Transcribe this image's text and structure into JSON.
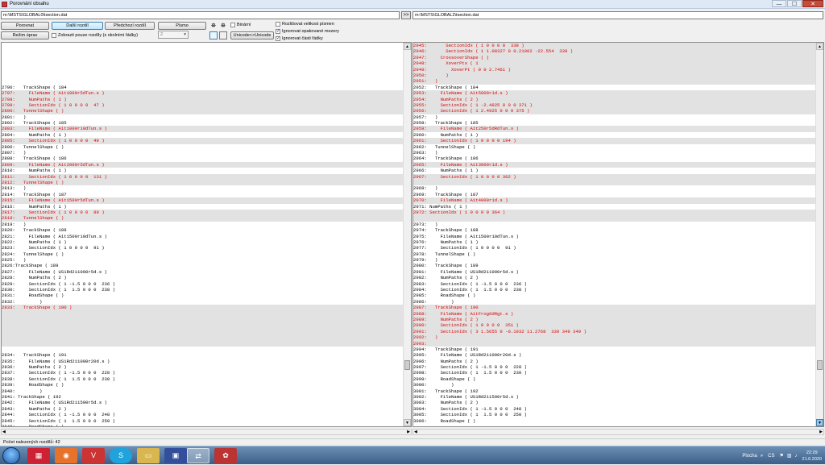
{
  "window": {
    "title": "Porovnání obsahu",
    "min": "—",
    "max": "☐",
    "close": "✕"
  },
  "paths": {
    "left": "m:\\MSTS\\GLOBAL0\\tsection.dat",
    "right": "m:\\MSTS\\GLOBAL2\\tsection.dat",
    "arrow": ">>"
  },
  "toolbar": {
    "compare": "Porovnat",
    "next_diff": "Další rozdíl",
    "prev_diff": "Předchozí rozdíl",
    "font": "Písmo",
    "edit_mode": "Režim úprav",
    "show_diffs_only": "Zobrazit pouze rozdíly (s okolními řádky)",
    "context_lines": "2",
    "binary": "Binární",
    "unicode": "Unicode<>Unicode",
    "case_sensitive": "Rozlišovat velikost písmen",
    "ignore_spaces": "Ignorovat opakované mezery",
    "ignore_parts": "Ignorovat části řádky"
  },
  "left_lines": [
    {
      "t": "",
      "c": "b"
    },
    {
      "t": "",
      "c": "b"
    },
    {
      "t": "",
      "c": "b"
    },
    {
      "t": "",
      "c": "b"
    },
    {
      "t": "",
      "c": "b"
    },
    {
      "t": "",
      "c": "b"
    },
    {
      "t": "",
      "c": "b"
    },
    {
      "t": "2796:   TrackShape ( 184",
      "c": ""
    },
    {
      "t": "2797:     FileName ( A1t1000r5dTun.s )",
      "c": "gr"
    },
    {
      "t": "2798:     NumPaths ( 1 )",
      "c": "gr"
    },
    {
      "t": "2799:     SectionIdx ( 1 0 0 0 0  47 )",
      "c": "gr"
    },
    {
      "t": "2800:   TunnelShape ( )",
      "c": "gr"
    },
    {
      "t": "2801:   )",
      "c": ""
    },
    {
      "t": "2802:   TrackShape ( 185",
      "c": ""
    },
    {
      "t": "2803:     FileName ( A1t1000r10dTun.s )",
      "c": "gr"
    },
    {
      "t": "2804:     NumPaths ( 1 )",
      "c": ""
    },
    {
      "t": "2805:     SectionIdx ( 1 0 0 0 0  49 )",
      "c": "gr"
    },
    {
      "t": "2806:   TunnelShape ( )",
      "c": ""
    },
    {
      "t": "2807:   )",
      "c": ""
    },
    {
      "t": "2808:   TrackShape ( 186",
      "c": ""
    },
    {
      "t": "2809:     FileName ( A1t2000r5dTun.s )",
      "c": "gr"
    },
    {
      "t": "2810:     NumPaths ( 1 )",
      "c": ""
    },
    {
      "t": "2811:     SectionIdx ( 1 0 0 0 0  131 )",
      "c": "gr"
    },
    {
      "t": "2812:   TunnelShape ( )",
      "c": "gr"
    },
    {
      "t": "2813:   )",
      "c": ""
    },
    {
      "t": "2814:   TrackShape ( 187",
      "c": ""
    },
    {
      "t": "2815:     FileName ( A1t1500r5dTun.s )",
      "c": "gr"
    },
    {
      "t": "2816:     NumPaths ( 1 )",
      "c": ""
    },
    {
      "t": "2817:     SectionIdx ( 1 0 0 0 0  89 )",
      "c": "gr"
    },
    {
      "t": "2818:   TunnelShape ( )",
      "c": "gr"
    },
    {
      "t": "2819:   )",
      "c": ""
    },
    {
      "t": "2820:   TrackShape ( 188",
      "c": ""
    },
    {
      "t": "2821:     FileName ( A1t1500r10dTun.s )",
      "c": ""
    },
    {
      "t": "2822:     NumPaths ( 1 )",
      "c": ""
    },
    {
      "t": "2823:     SectionIdx ( 1 0 0 0 0  91 )",
      "c": ""
    },
    {
      "t": "2824:   TunnelShape ( )",
      "c": ""
    },
    {
      "t": "2825:   )",
      "c": ""
    },
    {
      "t": "2826:TrackShape ( 189",
      "c": ""
    },
    {
      "t": "2827:     FileName ( US1Rd211000r5d.s )",
      "c": ""
    },
    {
      "t": "2828:     NumPaths ( 2 )",
      "c": ""
    },
    {
      "t": "2829:     SectionIdx ( 1 -1.5 0 0 0  236 )",
      "c": ""
    },
    {
      "t": "2830:     SectionIdx ( 1  1.5 0 0 0  238 )",
      "c": ""
    },
    {
      "t": "2831:     RoadShape ( )",
      "c": ""
    },
    {
      "t": "2832:         )",
      "c": ""
    },
    {
      "t": "2833:   TrackShape ( 190 )",
      "c": "gr"
    },
    {
      "t": "",
      "c": "g"
    },
    {
      "t": "",
      "c": "g"
    },
    {
      "t": "",
      "c": "g"
    },
    {
      "t": "",
      "c": "g"
    },
    {
      "t": "",
      "c": "g"
    },
    {
      "t": "",
      "c": "g"
    },
    {
      "t": "",
      "c": "b"
    },
    {
      "t": "2834:   TrackShape ( 191",
      "c": ""
    },
    {
      "t": "2835:     FileName ( US1Rd211000r20d.s )",
      "c": ""
    },
    {
      "t": "2836:     NumPaths ( 2 )",
      "c": ""
    },
    {
      "t": "2837:     SectionIdx ( 1 -1.5 0 0 0  228 )",
      "c": ""
    },
    {
      "t": "2838:     SectionIdx ( 1  1.5 0 0 0  230 )",
      "c": ""
    },
    {
      "t": "2839:     RoadShape ( )",
      "c": ""
    },
    {
      "t": "2840:         )",
      "c": ""
    },
    {
      "t": "2841: TrackShape ( 192",
      "c": ""
    },
    {
      "t": "2842:     FileName ( US1Rd211500r5d.s )",
      "c": ""
    },
    {
      "t": "2843:     NumPaths ( 2 )",
      "c": ""
    },
    {
      "t": "2844:     SectionIdx ( 1 -1.5 0 0 0  248 )",
      "c": ""
    },
    {
      "t": "2845:     SectionIdx ( 1  1.5 0 0 0  250 )",
      "c": ""
    },
    {
      "t": "2846:     RoadShape ( )",
      "c": ""
    }
  ],
  "right_lines": [
    {
      "t": "2945:       SectionIdx ( 1 0 0 0 0  338 )",
      "c": "gr"
    },
    {
      "t": "2946:       SectionIdx ( 1 1.08327 0 0.21002 -22.554  338 )",
      "c": "gr"
    },
    {
      "t": "2947:     CrossoverShape ( )",
      "c": "gr"
    },
    {
      "t": "2948:       XoverPts ( 1",
      "c": "gr"
    },
    {
      "t": "2949:         XoverPt ( 0 0 2.7461 )",
      "c": "gr"
    },
    {
      "t": "2950:       )",
      "c": "gr"
    },
    {
      "t": "2951:   )",
      "c": "gr"
    },
    {
      "t": "2952:   TrackShape ( 184",
      "c": ""
    },
    {
      "t": "2953:     FileName ( A1t5000r1d.s )",
      "c": "gr"
    },
    {
      "t": "2954:     NumPaths ( 2 )",
      "c": "gr"
    },
    {
      "t": "2955:     SectionIdx ( 1 -2.4925 0 0 0 371 )",
      "c": "gr"
    },
    {
      "t": "2956:     SectionIdx ( 1 2.4925 0 0 0 375 )",
      "c": "gr"
    },
    {
      "t": "2957:   )",
      "c": ""
    },
    {
      "t": "2958:   TrackShape ( 185",
      "c": ""
    },
    {
      "t": "2959:     FileName ( A1t250r5dRdTun.s )",
      "c": "gr"
    },
    {
      "t": "2960:     NumPaths ( 1 )",
      "c": ""
    },
    {
      "t": "2961:     SectionIdx ( 1 0 0 0 0 194 )",
      "c": "gr"
    },
    {
      "t": "2962:   TunnelShape ( )",
      "c": ""
    },
    {
      "t": "2963:   )",
      "c": ""
    },
    {
      "t": "2964:   TrackShape ( 186",
      "c": ""
    },
    {
      "t": "2965:     FileName ( A1t3000r1d.s )",
      "c": "gr"
    },
    {
      "t": "2966:     NumPaths ( 1 )",
      "c": ""
    },
    {
      "t": "2967:     SectionIdx ( 1 0 0 0 0 362 )",
      "c": "gr"
    },
    {
      "t": "",
      "c": "g"
    },
    {
      "t": "2968:   )",
      "c": ""
    },
    {
      "t": "2969:   TrackShape ( 187",
      "c": ""
    },
    {
      "t": "2970:     FileName ( A1t4000r1d.s )",
      "c": "gr"
    },
    {
      "t": "2971: NumPaths ( 1 )",
      "c": ""
    },
    {
      "t": "2972: SectionIdx ( 1 0 0 0 0 364 )",
      "c": "gr"
    },
    {
      "t": "",
      "c": "g"
    },
    {
      "t": "2973:   )",
      "c": ""
    },
    {
      "t": "2974:   TrackShape ( 188",
      "c": ""
    },
    {
      "t": "2975:     FileName ( A1t1500r10dTun.s )",
      "c": ""
    },
    {
      "t": "2976:     NumPaths ( 1 )",
      "c": ""
    },
    {
      "t": "2977:     SectionIdx ( 1 0 0 0 0  91 )",
      "c": ""
    },
    {
      "t": "2978:   TunnelShape ( )",
      "c": ""
    },
    {
      "t": "2979:   )",
      "c": ""
    },
    {
      "t": "2980:   TrackShape ( 189",
      "c": ""
    },
    {
      "t": "2981:     FileName ( US1Rd211000r5d.s )",
      "c": ""
    },
    {
      "t": "2982:     NumPaths ( 2 )",
      "c": ""
    },
    {
      "t": "2983:     SectionIdx ( 1 -1.5 0 0 0  236 )",
      "c": ""
    },
    {
      "t": "2984:     SectionIdx ( 1  1.5 0 0 0  238 )",
      "c": ""
    },
    {
      "t": "2985:     RoadShape ( )",
      "c": ""
    },
    {
      "t": "2986:         )",
      "c": ""
    },
    {
      "t": "2987:   TrackShape ( 190",
      "c": "gr"
    },
    {
      "t": "2988:     FileName ( A1tFrog6dRgt.s )",
      "c": "gr"
    },
    {
      "t": "2989:     NumPaths ( 2 )",
      "c": "gr"
    },
    {
      "t": "2990:     SectionIdx ( 1 0 0 0 0  351 )",
      "c": "gr"
    },
    {
      "t": "2991:     SectionIdx ( 3 1.5655 0 -0.1932 11.2768  330 349 349 )",
      "c": "gr"
    },
    {
      "t": "2992:   )",
      "c": "gr"
    },
    {
      "t": "2993:",
      "c": "gr"
    },
    {
      "t": "2994:   TrackShape ( 191",
      "c": ""
    },
    {
      "t": "2995:     FileName ( US1Rd211000r20d.s )",
      "c": ""
    },
    {
      "t": "2996:     NumPaths ( 2 )",
      "c": ""
    },
    {
      "t": "2997:     SectionIdx ( 1 -1.5 0 0 0  228 )",
      "c": ""
    },
    {
      "t": "2998:     SectionIdx ( 1  1.5 0 0 0  230 )",
      "c": ""
    },
    {
      "t": "2999:     RoadShape ( )",
      "c": ""
    },
    {
      "t": "3000:         )",
      "c": ""
    },
    {
      "t": "3001:   TrackShape ( 192",
      "c": ""
    },
    {
      "t": "3002:     FileName ( US1Rd211500r5d.s )",
      "c": ""
    },
    {
      "t": "3003:     NumPaths ( 2 )",
      "c": ""
    },
    {
      "t": "3004:     SectionIdx ( 1 -1.5 0 0 0  248 )",
      "c": ""
    },
    {
      "t": "3005:     SectionIdx ( 1  1.5 0 0 0  250 )",
      "c": ""
    },
    {
      "t": "3006:     RoadShape ( )",
      "c": ""
    }
  ],
  "status": "Počet nalezených rozdílů: 42",
  "taskbar": {
    "items": [
      "media-player",
      "firefox",
      "vivaldi",
      "skype",
      "explorer",
      "floppy",
      "compare-tool",
      "paint"
    ],
    "tray_label": "Plocha",
    "lang": "CS",
    "time": "22:29",
    "date": "21.6.2020"
  },
  "colors": {
    "diff_text": "#dd0000",
    "diff_bg": "#e2e2e2",
    "accent": "#3c7fb1"
  }
}
